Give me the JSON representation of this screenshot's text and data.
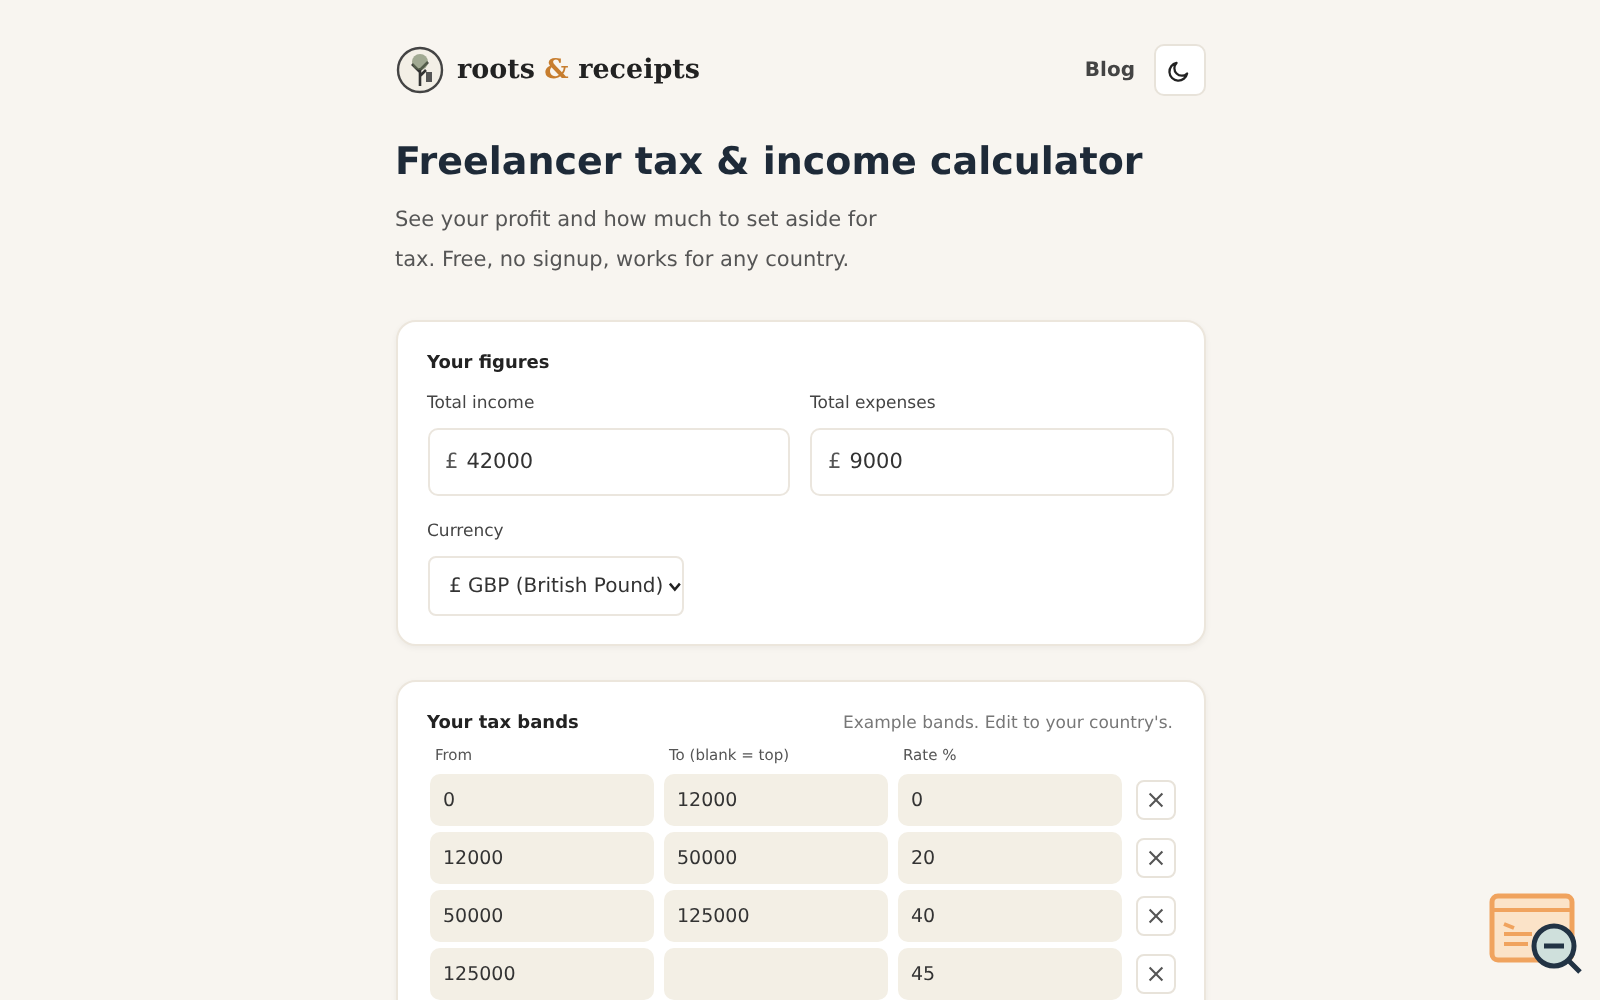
{
  "header": {
    "brand": {
      "prefix": "roots ",
      "amp": "&",
      "suffix": " receipts"
    },
    "nav_link": "Blog"
  },
  "title": "Freelancer tax & income calculator",
  "subtitle": "See your profit and how much to set aside for tax. Free, no signup, works for any country.",
  "figures": {
    "heading": "Your figures",
    "fields": [
      {
        "label": "Total income",
        "symbol": "£",
        "value": "42000"
      },
      {
        "label": "Total expenses",
        "symbol": "£",
        "value": "9000"
      }
    ],
    "currency": {
      "label": "Currency",
      "value": "£ GBP (British Pound)"
    }
  },
  "bands": {
    "heading": "Your tax bands",
    "note": "Example bands. Edit to your country's.",
    "columns": [
      "From",
      "To (blank = top)",
      "Rate %"
    ],
    "rows": [
      {
        "from": "0",
        "to": "12000",
        "rate": "0"
      },
      {
        "from": "12000",
        "to": "50000",
        "rate": "20"
      },
      {
        "from": "50000",
        "to": "125000",
        "rate": "40"
      },
      {
        "from": "125000",
        "rate": "45"
      }
    ]
  }
}
